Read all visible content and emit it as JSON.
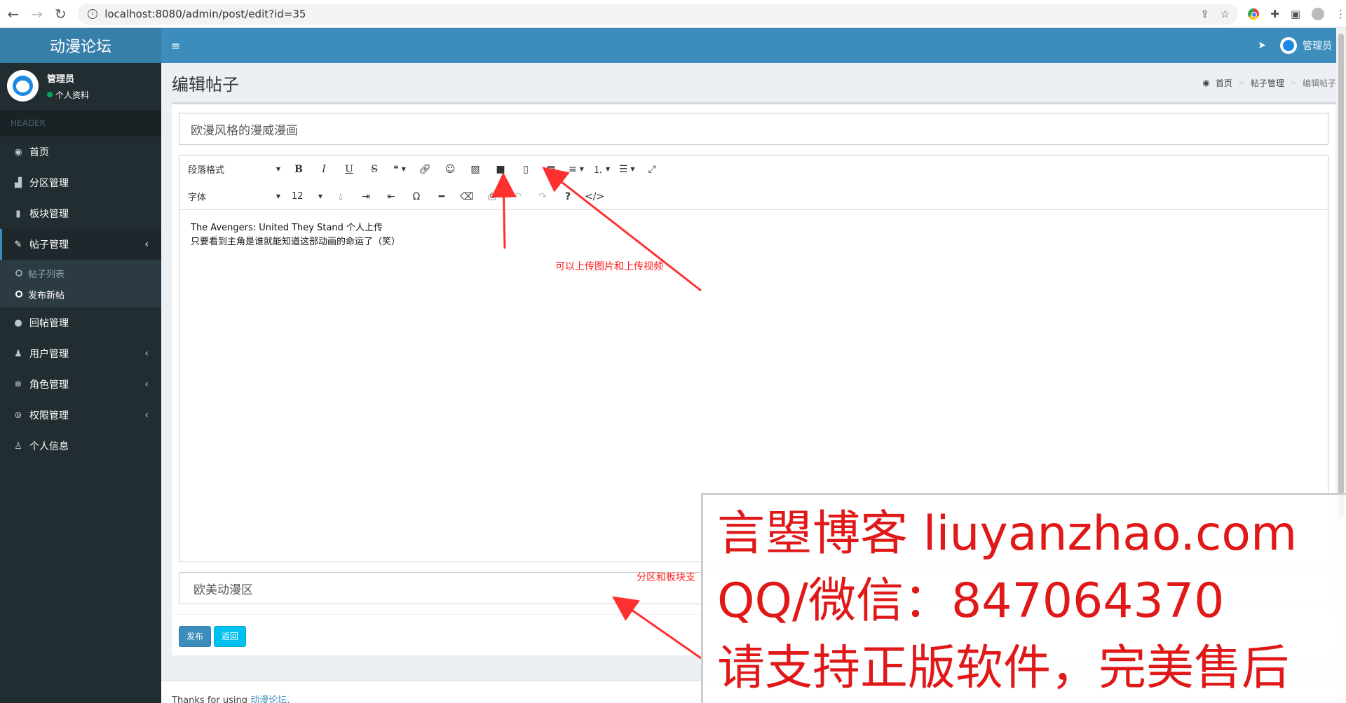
{
  "browser": {
    "url": "localhost:8080/admin/post/edit?id=35",
    "icons": [
      "back-icon",
      "forward-icon",
      "reload-icon",
      "site-info-icon",
      "share-icon",
      "star-icon",
      "chrome-icon",
      "extensions-icon",
      "sidepanel-icon",
      "profile-icon",
      "menu-icon"
    ]
  },
  "header": {
    "logo": "动漫论坛",
    "user_name": "管理员"
  },
  "sidebar": {
    "user_name": "管理员",
    "user_status": "个人资料",
    "menu_header": "HEADER",
    "items": [
      {
        "label": "首页",
        "icon": "dashboard-icon"
      },
      {
        "label": "分区管理",
        "icon": "chart-icon"
      },
      {
        "label": "板块管理",
        "icon": "book-icon"
      },
      {
        "label": "帖子管理",
        "icon": "brush-icon"
      },
      {
        "label": "回帖管理",
        "icon": "comments-icon"
      },
      {
        "label": "用户管理",
        "icon": "users-icon"
      },
      {
        "label": "角色管理",
        "icon": "snowflake-icon"
      },
      {
        "label": "权限管理",
        "icon": "key-icon"
      },
      {
        "label": "个人信息",
        "icon": "user-icon"
      }
    ],
    "sub_items": [
      {
        "label": "帖子列表"
      },
      {
        "label": "发布新帖"
      }
    ]
  },
  "page": {
    "title": "编辑帖子",
    "breadcrumb": [
      "首页",
      "帖子管理",
      "编辑帖子"
    ]
  },
  "form": {
    "title_value": "欧漫风格的漫威漫画",
    "category_value": "欧美动漫区",
    "submit_label": "发布",
    "back_label": "返回"
  },
  "editor": {
    "paragraph_format": "段落格式",
    "font_family": "字体",
    "font_size": "12",
    "content_line1": "The Avengers: United They Stand 个人上传",
    "content_line2": "只要看到主角是谁就能知道这部动画的命运了（笑）"
  },
  "annotations": {
    "upload_note": "可以上传图片和上传视频",
    "category_note": "分区和板块支"
  },
  "watermark": {
    "line1": "言曌博客 liuyanzhao.com",
    "line2": "QQ/微信：847064370",
    "line3": "请支持正版软件，完美售后"
  },
  "footer": {
    "prefix": "Thanks for using ",
    "link": "动漫论坛",
    "suffix": "."
  }
}
